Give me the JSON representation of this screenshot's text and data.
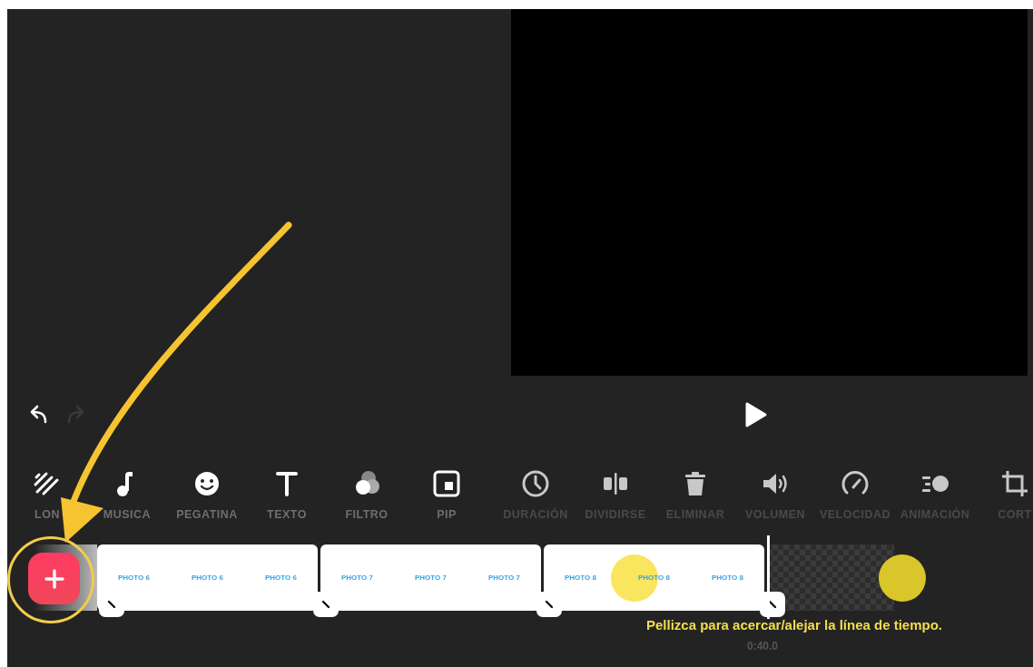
{
  "history": [
    {
      "kind": "undo",
      "disabled": false
    },
    {
      "kind": "redo",
      "disabled": true
    }
  ],
  "toolbar": {
    "tools": [
      {
        "kind": "canvas",
        "label": "LON",
        "disabled": false
      },
      {
        "kind": "music",
        "label": "MUSICA",
        "disabled": false
      },
      {
        "kind": "sticker",
        "label": "PEGATINA",
        "disabled": false
      },
      {
        "kind": "text",
        "label": "TEXTO",
        "disabled": false
      },
      {
        "kind": "filter",
        "label": "FILTRO",
        "disabled": false
      },
      {
        "kind": "pip",
        "label": "PIP",
        "disabled": false
      },
      {
        "kind": "duration",
        "label": "DURACIÓN",
        "disabled": true
      },
      {
        "kind": "split",
        "label": "DIVIDIRSE",
        "disabled": true
      },
      {
        "kind": "delete",
        "label": "ELIMINAR",
        "disabled": true
      },
      {
        "kind": "volume",
        "label": "VOLUMEN",
        "disabled": true
      },
      {
        "kind": "speed",
        "label": "VELOCIDAD",
        "disabled": true
      },
      {
        "kind": "animation",
        "label": "ANIMACIÓN",
        "disabled": true
      },
      {
        "kind": "crop",
        "label": "CORT",
        "disabled": true
      }
    ]
  },
  "timeline": {
    "clips": [
      {
        "labels": [
          "PHOTO 6",
          "PHOTO 6",
          "PHOTO 6"
        ]
      },
      {
        "labels": [
          "PHOTO 7",
          "PHOTO 7",
          "PHOTO 7"
        ]
      },
      {
        "labels": [
          "PHOTO 8",
          "PHOTO 8",
          "PHOTO 8"
        ]
      }
    ],
    "hint": "Pellizca para acercar/alejar la línea de tiempo.",
    "time": "0:40.0"
  }
}
